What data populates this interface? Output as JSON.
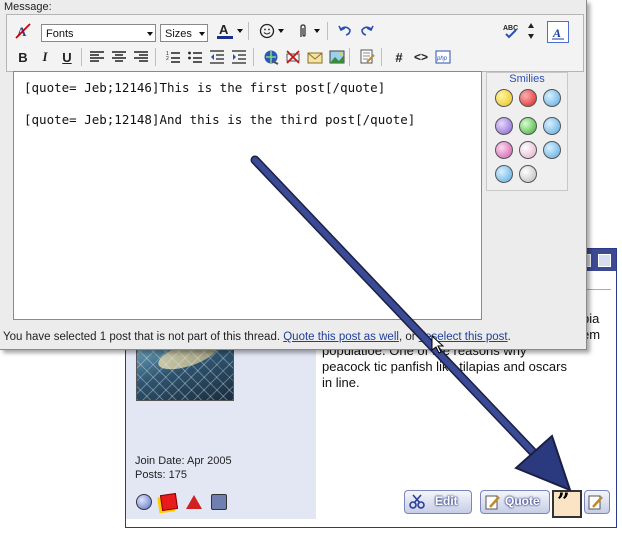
{
  "editor": {
    "label": "Message:",
    "font_select": "Fonts",
    "size_select": "Sizes",
    "text_lines": [
      "[quote= Jeb;12146]This is the first post[/quote]",
      "[quote= Jeb;12148]And this is the third post[/quote]"
    ],
    "smilies_title": "Smilies",
    "status": {
      "prefix": "You have selected 1 post that is not part of this thread. ",
      "quote_link": "Quote this post as well",
      "middle": ", or ",
      "deselect_link": "deselect this post",
      "suffix": "."
    }
  },
  "post": {
    "join_date": "Join Date: Apr 2005",
    "posts": "Posts: 175",
    "text_lines": [
      "pia",
      "em",
      "populatioe. One of the reasons why",
      "peacock tic panfish like tilapias and oscars",
      "in line."
    ],
    "edit_label": "Edit",
    "quote_label": "Quote",
    "multiquote_glyph": "”"
  },
  "colors": {
    "panel_border": "#2a3a8a",
    "titlebar": "#3d4a92",
    "link": "#1f3e9c",
    "arrow": "#2b3a7e"
  },
  "icons": {
    "toolbar_row1": [
      "remove-format-icon",
      "font-color-icon",
      "smiley-icon",
      "attach-icon",
      "undo-icon",
      "redo-icon",
      "spell-check-icon",
      "resize-icon",
      "switch-mode-icon"
    ],
    "toolbar_row2": [
      "bold-icon",
      "italic-icon",
      "underline-icon",
      "align-left-icon",
      "align-center-icon",
      "align-right-icon",
      "ordered-list-icon",
      "unordered-list-icon",
      "outdent-icon",
      "indent-icon",
      "link-icon",
      "unlink-icon",
      "email-icon",
      "image-icon",
      "quote-icon",
      "hash-icon",
      "code-icon",
      "php-icon"
    ]
  }
}
